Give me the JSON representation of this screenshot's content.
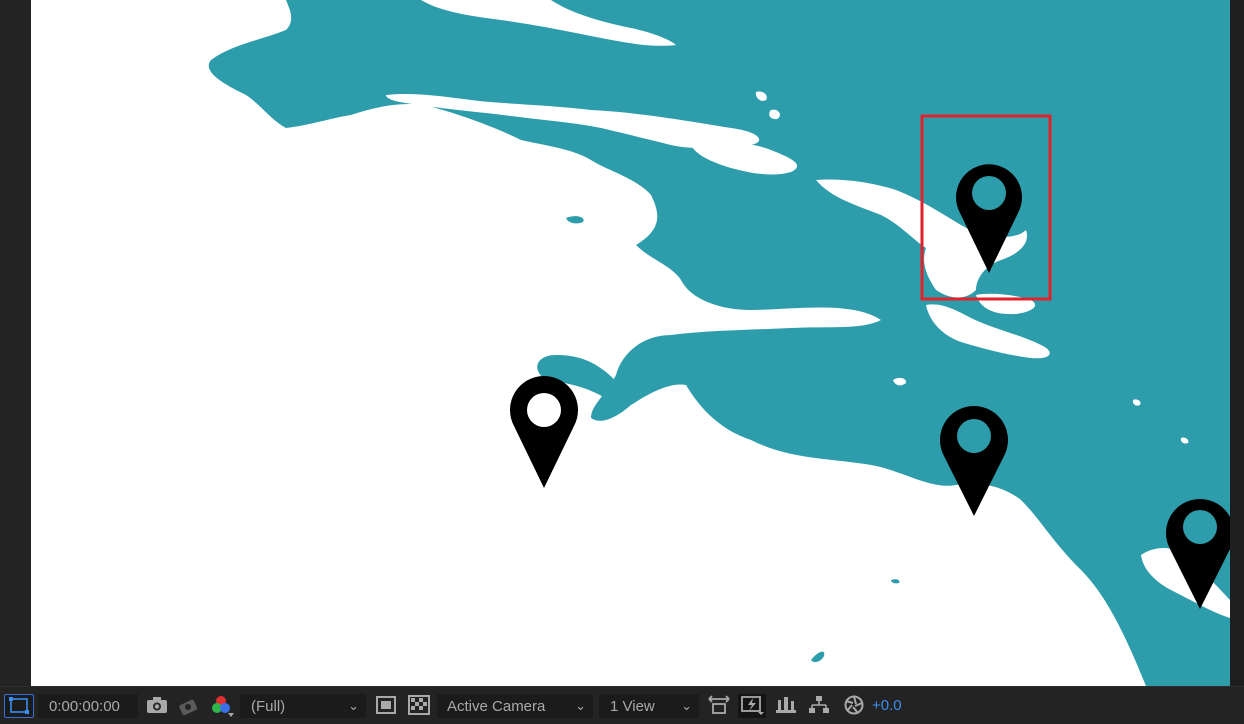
{
  "viewer": {
    "background": "#ffffff",
    "water_color": "#2e9dab",
    "selection_color": "#e1212b",
    "pins": [
      {
        "name": "map-pin-left"
      },
      {
        "name": "map-pin-selected"
      },
      {
        "name": "map-pin-middle-right"
      },
      {
        "name": "map-pin-far-right"
      }
    ]
  },
  "toolbar": {
    "timecode": "0:00:00:00",
    "resolution": "(Full)",
    "camera": "Active Camera",
    "views": "1 View",
    "exposure": "+0.0",
    "icons": [
      "region-of-interest-icon",
      "snapshot-camera-icon",
      "show-snapshot-icon",
      "color-channels-icon",
      "toggle-mask-icon",
      "transparency-grid-icon",
      "fast-previews-icon",
      "timeline-icon",
      "flowchart-icon",
      "exposure-icon"
    ]
  }
}
